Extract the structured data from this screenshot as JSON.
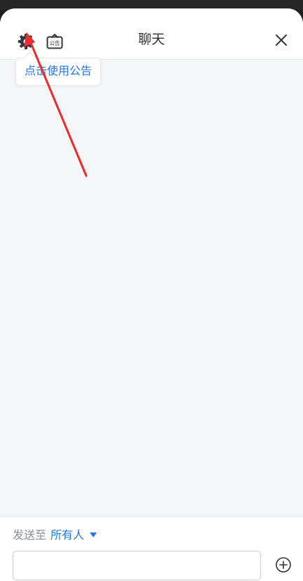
{
  "header": {
    "title": "聊天",
    "settings_icon": "gear-icon",
    "notice_icon": "announcement-icon",
    "notice_icon_text": "公告",
    "close_icon": "close-icon"
  },
  "tooltip": {
    "text": "点击使用公告"
  },
  "footer": {
    "send_to_label": "发送至",
    "recipient": "所有人",
    "message_placeholder": "",
    "add_icon": "plus-circle-icon"
  },
  "colors": {
    "accent": "#2478e3",
    "text_primary": "#2f3136",
    "text_secondary": "#8b8f97",
    "background": "#f5f6f8",
    "annotation_arrow": "#ef2b2b"
  }
}
